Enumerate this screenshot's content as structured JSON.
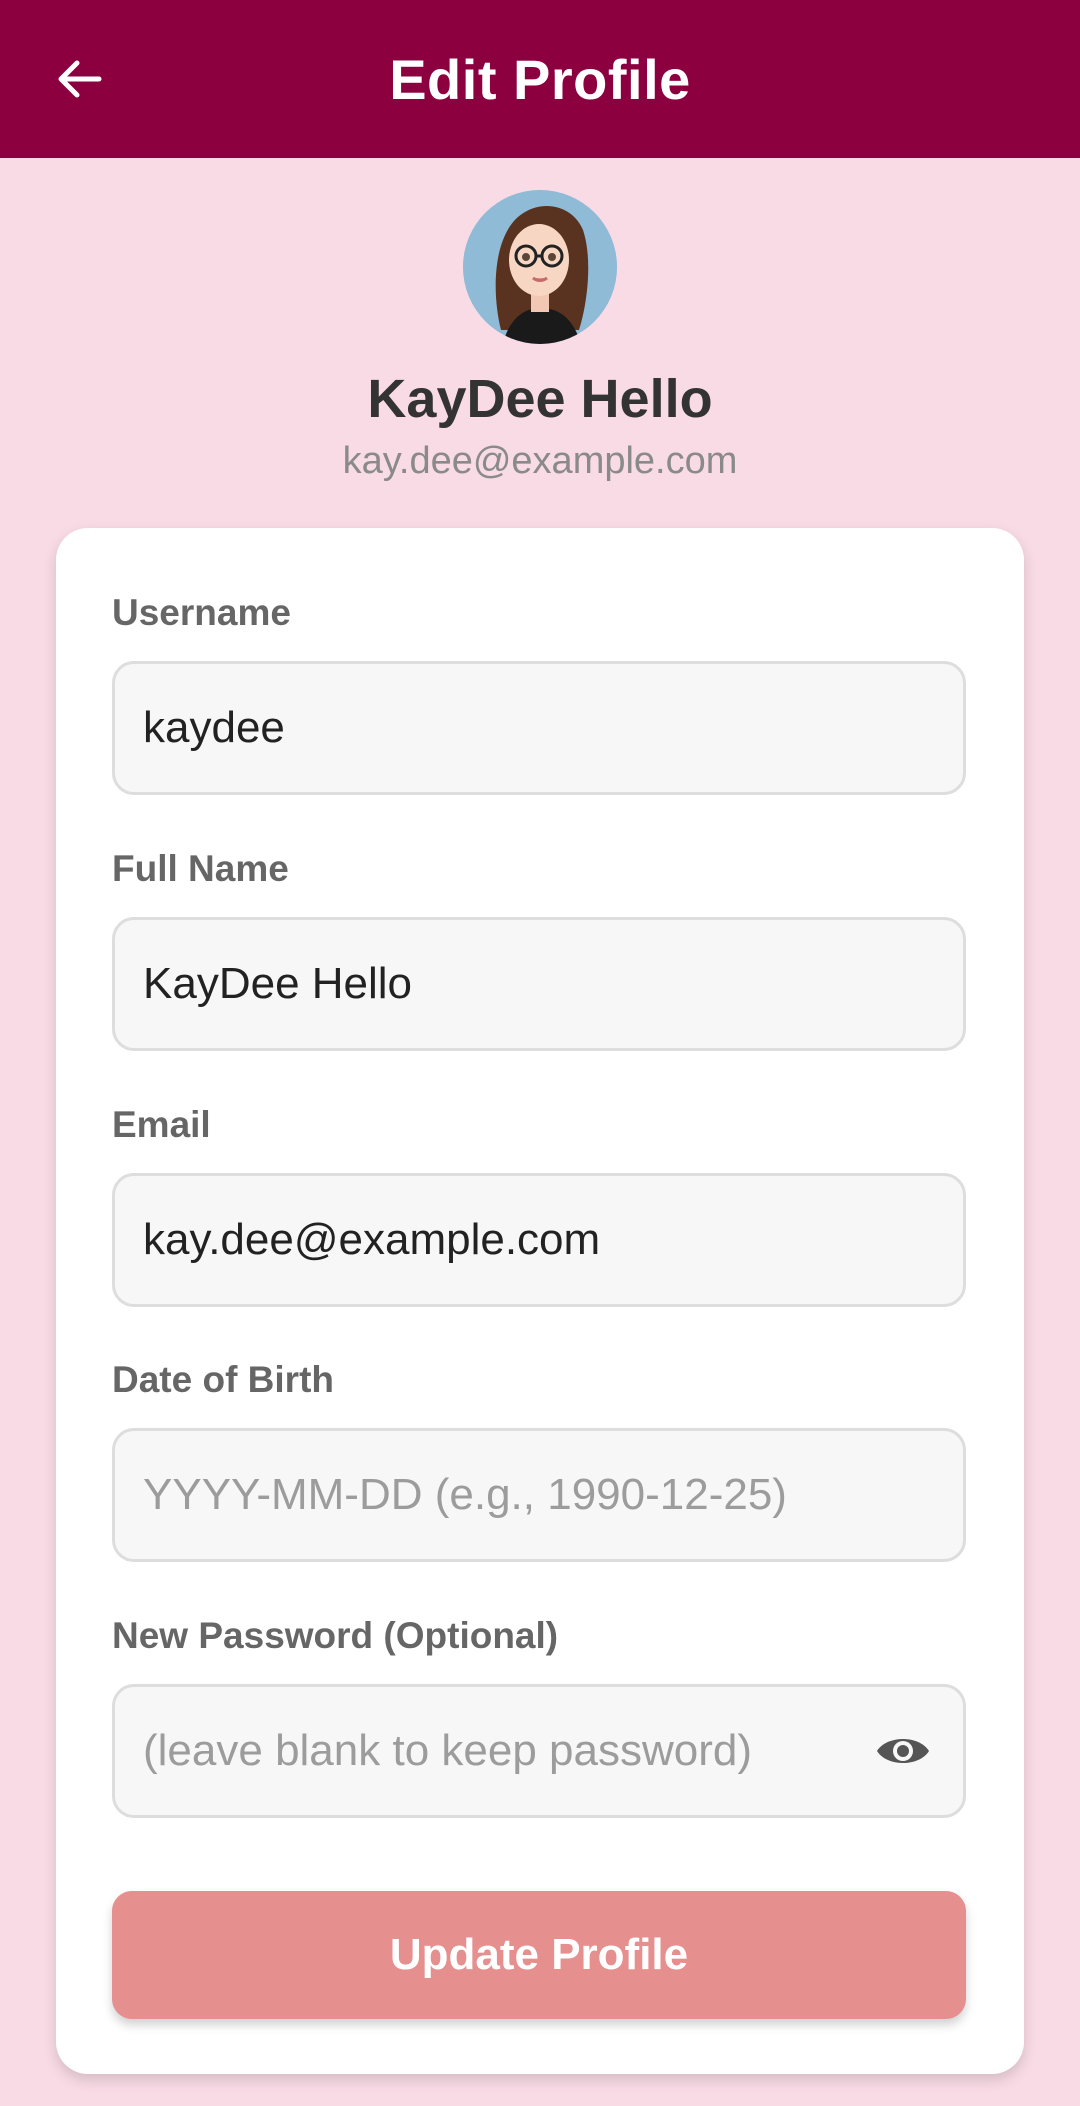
{
  "app_bar": {
    "title": "Edit Profile",
    "back_icon": "arrow-left-icon",
    "background": "#8c0040"
  },
  "profile": {
    "name": "KayDee Hello",
    "email": "kay.dee@example.com",
    "avatar_icon": "cartoon-avatar"
  },
  "form": {
    "username": {
      "label": "Username",
      "value": "kaydee",
      "placeholder": ""
    },
    "full_name": {
      "label": "Full Name",
      "value": "KayDee Hello",
      "placeholder": ""
    },
    "email": {
      "label": "Email",
      "value": "kay.dee@example.com",
      "placeholder": ""
    },
    "dob": {
      "label": "Date of Birth",
      "value": "",
      "placeholder": "YYYY-MM-DD (e.g., 1990-12-25)"
    },
    "password": {
      "label": "New Password (Optional)",
      "value": "",
      "placeholder": "(leave blank to keep password)",
      "toggle_icon": "eye-icon"
    },
    "submit_label": "Update Profile"
  },
  "colors": {
    "page_background": "#f9dbe5",
    "button": "#e68f8f"
  }
}
